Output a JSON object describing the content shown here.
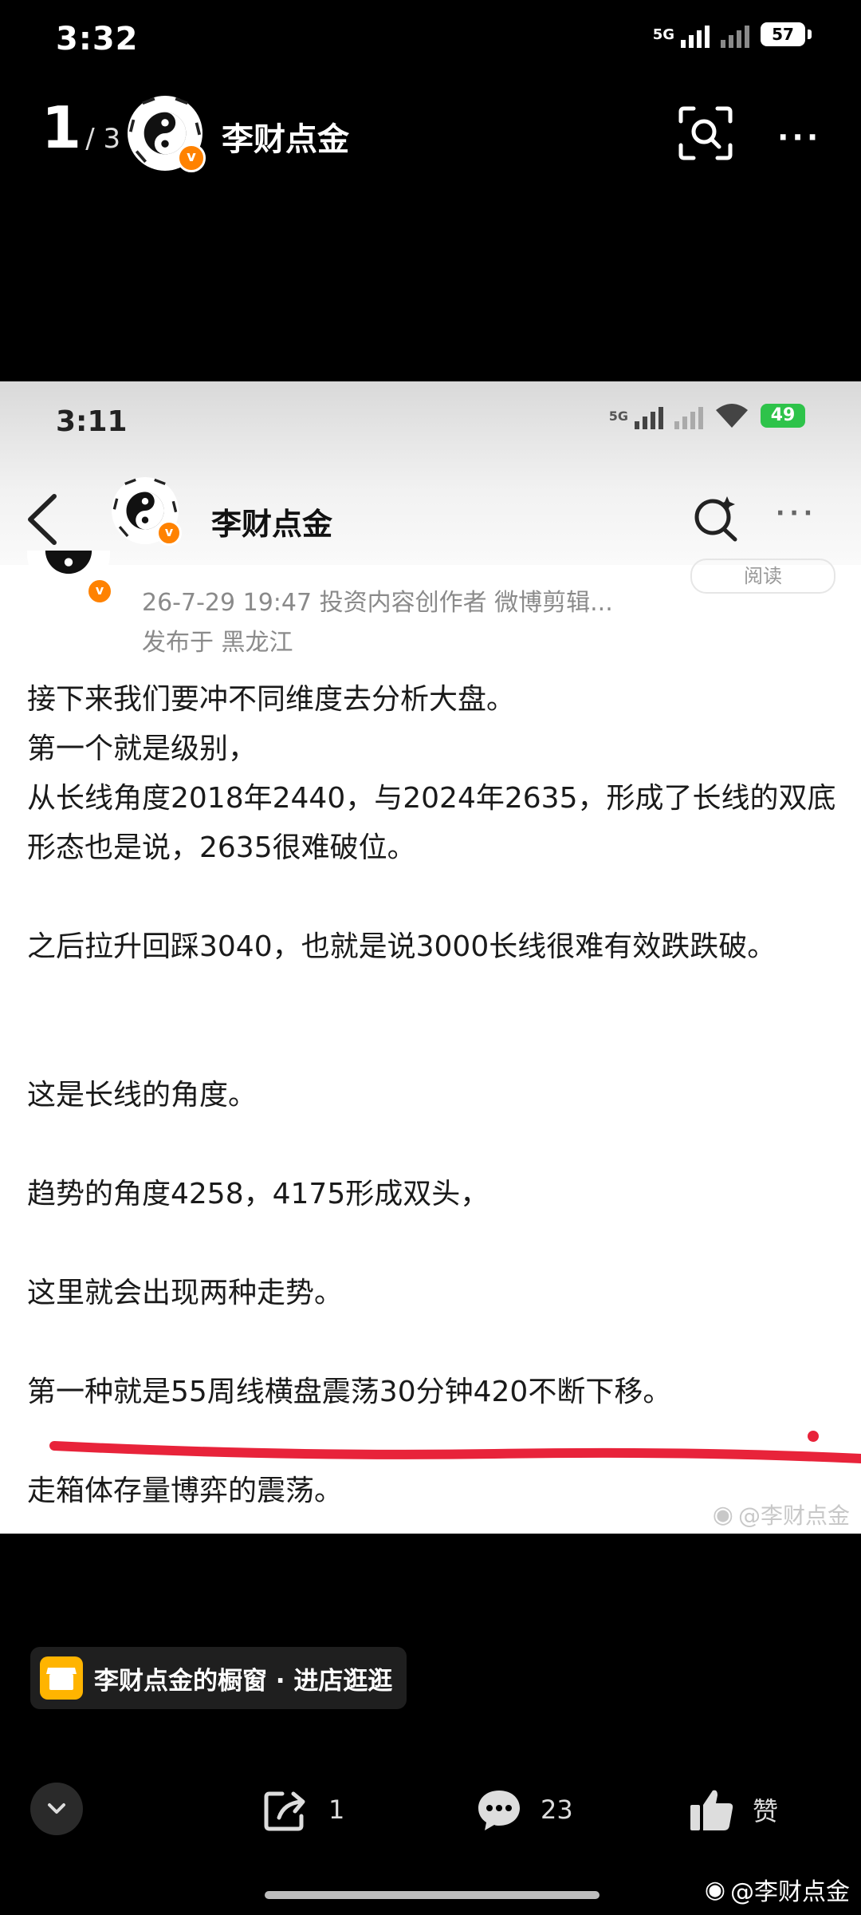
{
  "status": {
    "time": "3:32",
    "network": "5G",
    "battery": "57"
  },
  "header": {
    "counter_current": "1",
    "counter_total": "/ 3",
    "author": "李财点金"
  },
  "inner": {
    "status": {
      "time": "3:11",
      "network": "5G",
      "battery": "49"
    },
    "author": "李财点金",
    "read_chip": "阅读",
    "meta_line": "26-7-29 19:47   投资内容创作者 微博剪辑...",
    "location": "发布于 黑龙江",
    "paragraphs": [
      "接下来我们要冲不同维度去分析大盘。",
      "第一个就是级别，",
      "从长线角度2018年2440，与2024年2635，形成了长线的双底形态也是说，2635很难破位。",
      "之后拉升回踩3040，也就是说3000长线很难有效跌跌破。",
      "这是长线的角度。",
      "趋势的角度4258，4175形成双头，",
      "这里就会出现两种走势。",
      "第一种就是55周线横盘震荡30分钟420不断下移。",
      "走箱体存量博弈的震荡。"
    ],
    "watermark": "@李财点金"
  },
  "shop": {
    "label": "李财点金的橱窗 · 进店逛逛"
  },
  "actions": {
    "share_count": "1",
    "comment_count": "23",
    "like_label": "赞"
  },
  "bottom_watermark": "@李财点金",
  "colors": {
    "accent_red": "#e8233a",
    "verified_badge": "#ff8200",
    "shop_icon": "#ffb400",
    "battery_green": "#2ec34a"
  },
  "icons": [
    "yin-yang-avatar",
    "verified-badge-icon",
    "scan-icon",
    "more-icon",
    "back-arrow-icon",
    "search-icon",
    "shop-icon",
    "chevron-down-icon",
    "share-icon",
    "comment-icon",
    "thumb-up-icon",
    "weibo-logo-icon"
  ]
}
